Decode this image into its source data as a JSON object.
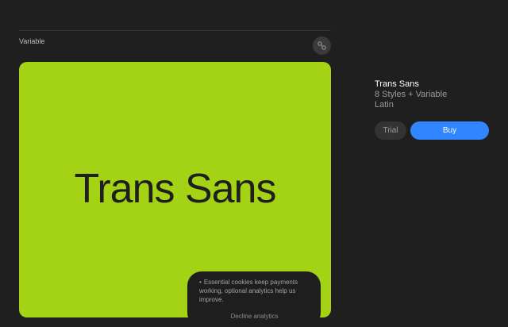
{
  "viewer": {
    "variant_label": "Variable",
    "tool_icon": "link-icon",
    "preview_text": "Trans Sans",
    "preview_bg": "#a4d316",
    "preview_text_color": "#1f1f1f"
  },
  "cookie_banner": {
    "bullet": "•",
    "message": "Essential cookies keep payments working, optional analytics help us improve.",
    "decline_label": "Decline analytics"
  },
  "product": {
    "name": "Trans Sans",
    "styles": "8 Styles + Variable",
    "script": "Latin"
  },
  "actions": {
    "trial_label": "Trial",
    "buy_label": "Buy",
    "buy_color": "#3186ff"
  }
}
